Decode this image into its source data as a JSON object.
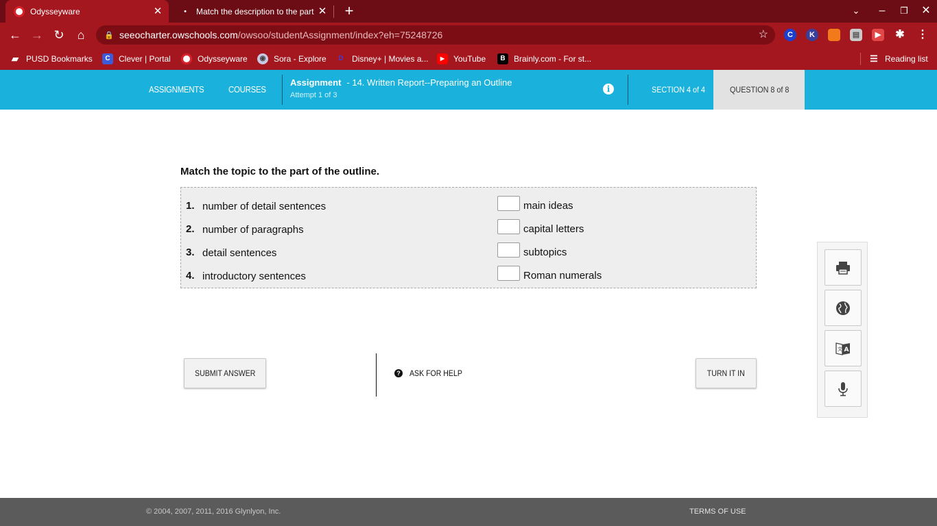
{
  "browser": {
    "tabs": [
      {
        "title": "Odysseyware",
        "icon": "odysseyware-icon",
        "active": true
      },
      {
        "title": "Match the description to the part",
        "icon": "loading-spinner-icon",
        "active": false
      }
    ],
    "url_domain": "seeocharter.owschools.com",
    "url_path": "/owsoo/studentAssignment/index?eh=75248726",
    "extensions": [
      "clever-icon",
      "k-extension-icon",
      "orange-extension-icon",
      "printer-extension-icon",
      "red-extension-icon",
      "puzzle-icon"
    ],
    "bookmarks": [
      {
        "label": "PUSD Bookmarks",
        "icon": "folder-icon"
      },
      {
        "label": "Clever | Portal",
        "icon": "clever-icon"
      },
      {
        "label": "Odysseyware",
        "icon": "odysseyware-icon"
      },
      {
        "label": "Sora - Explore",
        "icon": "sora-icon"
      },
      {
        "label": "Disney+ | Movies a...",
        "icon": "disney-icon"
      },
      {
        "label": "YouTube",
        "icon": "youtube-icon"
      },
      {
        "label": "Brainly.com - For st...",
        "icon": "brainly-icon"
      }
    ],
    "reading_list": "Reading list",
    "colors": {
      "tab_strip": "#6c0c14",
      "toolbar": "#a4171f"
    }
  },
  "header": {
    "nav": [
      "ASSIGNMENTS",
      "COURSES"
    ],
    "assignment_label": "Assignment",
    "assignment_name": "- 14. Written Report--Preparing an Outline",
    "attempt": "Attempt 1 of 3",
    "section": "SECTION 4 of 4",
    "question": "QUESTION 8 of 8",
    "colors": {
      "bar": "#1ab2dc",
      "active_tab": "#e2e2e2"
    }
  },
  "question": {
    "prompt": "Match the topic to the part of the outline.",
    "items": [
      {
        "num": "1.",
        "text": "number of detail sentences",
        "input_value": "",
        "answer": "main ideas"
      },
      {
        "num": "2.",
        "text": "number of paragraphs",
        "input_value": "",
        "answer": "capital letters"
      },
      {
        "num": "3.",
        "text": "detail sentences",
        "input_value": "",
        "answer": "subtopics"
      },
      {
        "num": "4.",
        "text": "introductory sentences",
        "input_value": "",
        "answer": "Roman numerals"
      }
    ]
  },
  "actions": {
    "submit": "SUBMIT ANSWER",
    "help": "ASK FOR HELP",
    "turn_in": "TURN IT IN"
  },
  "tools": [
    "printer-icon",
    "globe-icon",
    "translate-icon",
    "microphone-icon"
  ],
  "footer": {
    "copyright": "© 2004, 2007, 2011, 2016 Glynlyon, Inc.",
    "terms": "TERMS OF USE",
    "color": "#5b5b5b"
  }
}
